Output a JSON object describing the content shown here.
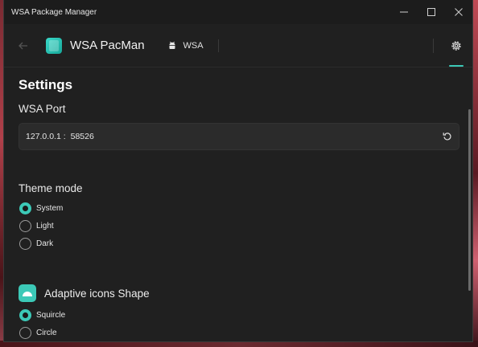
{
  "window": {
    "title": "WSA Package Manager",
    "controls": [
      "minimize",
      "maximize",
      "close"
    ]
  },
  "nav": {
    "app_name": "WSA PacMan",
    "items": [
      {
        "label": "WSA",
        "icon": "android-icon"
      }
    ],
    "active": "settings"
  },
  "settings": {
    "heading": "Settings",
    "wsa_port": {
      "label": "WSA Port",
      "host": "127.0.0.1 :",
      "value": "58526"
    },
    "theme": {
      "label": "Theme mode",
      "options": [
        "System",
        "Light",
        "Dark"
      ],
      "selected": "System"
    },
    "icon_shape": {
      "label": "Adaptive icons Shape",
      "options": [
        "Squircle",
        "Circle"
      ],
      "selected": "Squircle"
    }
  },
  "colors": {
    "accent": "#3cc9b7",
    "background": "#202020",
    "input_bg": "#2b2b2b"
  }
}
